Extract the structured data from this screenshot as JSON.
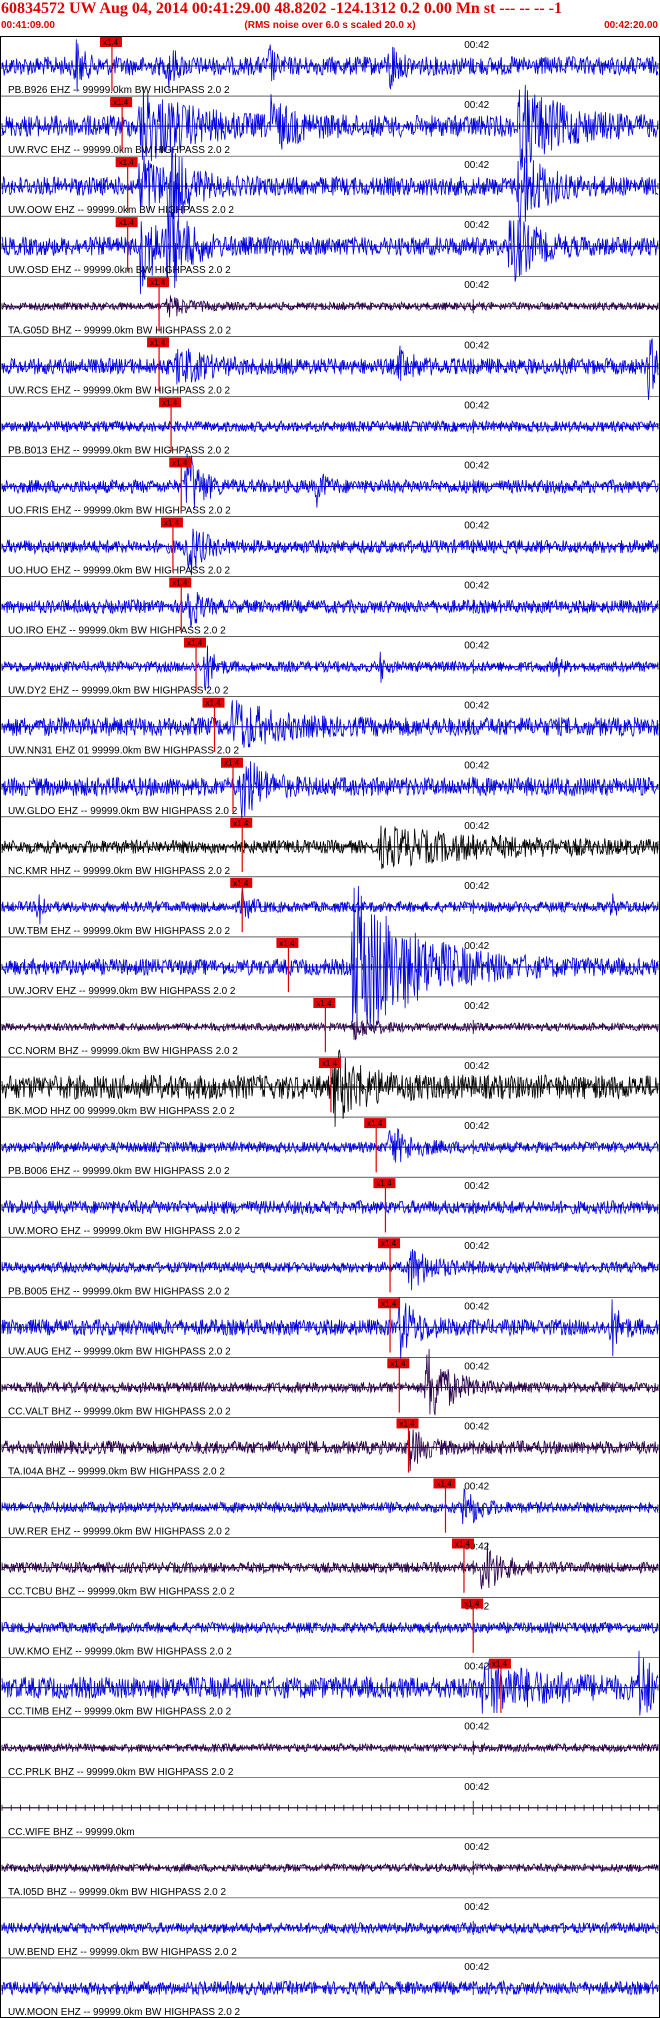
{
  "header": {
    "title": "60834572 UW Aug 04, 2014 00:41:29.00   48.8202 -124.1312  0.2 0.00 Mn st --- -- --  -1",
    "subtitle": "(RMS noise over 6.0 s scaled 20.0 x)",
    "start_time": "00:41:09.00",
    "end_time": "00:42:20.00"
  },
  "colors": {
    "header_text": "#e00000",
    "pick": "#e00000",
    "blue_trace": "#0000e0",
    "purple_trace": "#2a004a",
    "black_trace": "#000000",
    "grid": "#000000"
  },
  "chart_data": {
    "type": "seismogram",
    "x_start": "00:41:09.00",
    "x_end": "00:42:20.00",
    "minute_tick_label": "00:42",
    "pick_label": "x1.4",
    "filter": "HIGHPASS  2.0  2",
    "traces": [
      {
        "label": "PB.B926 EHZ -- 99999.0km BW  HIGHPASS  2.0  2",
        "color": "blue",
        "amplitude": 0.35,
        "pick": "00:41:20.9",
        "events": [
          [
            "00:41:17",
            0.9,
            1.5
          ],
          [
            "00:41:27",
            0.8,
            1.5
          ],
          [
            "00:41:38",
            0.7,
            1.0
          ],
          [
            "00:41:51",
            1.0,
            1.5
          ]
        ]
      },
      {
        "label": "UW.RVC EHZ -- 99999.0km BW  HIGHPASS  2.0  2",
        "color": "blue",
        "amplitude": 0.4,
        "pick": "00:41:22.0",
        "events": [
          [
            "00:41:24",
            1.3,
            10
          ],
          [
            "00:41:38",
            0.8,
            5
          ],
          [
            "00:42:05",
            1.4,
            9
          ]
        ]
      },
      {
        "label": "UW.OOW EHZ -- 99999.0km BW  HIGHPASS  2.0  2",
        "color": "blue",
        "amplitude": 0.35,
        "pick": "00:41:22.6",
        "events": [
          [
            "00:41:24",
            1.2,
            5
          ],
          [
            "00:41:27",
            1.4,
            4
          ],
          [
            "00:42:05",
            1.6,
            5
          ]
        ]
      },
      {
        "label": "UW.OSD EHZ -- 99999.0km BW  HIGHPASS  2.0  2",
        "color": "blue",
        "amplitude": 0.35,
        "pick": "00:41:22.6",
        "events": [
          [
            "00:41:24",
            1.5,
            4
          ],
          [
            "00:41:27",
            1.6,
            4
          ],
          [
            "00:42:04",
            1.3,
            5
          ]
        ]
      },
      {
        "label": "TA.G05D BHZ -- 99999.0km BW  HIGHPASS  2.0  2",
        "color": "purple",
        "amplitude": 0.15,
        "pick": "00:41:26.0",
        "events": [
          [
            "00:41:27",
            0.4,
            4
          ]
        ]
      },
      {
        "label": "UW.RCS EHZ -- 99999.0km BW  HIGHPASS  2.0  2",
        "color": "blue",
        "amplitude": 0.3,
        "pick": "00:41:26.0",
        "events": [
          [
            "00:41:28",
            0.6,
            6
          ],
          [
            "00:41:52",
            0.5,
            3
          ],
          [
            "00:42:19",
            1.1,
            2
          ]
        ]
      },
      {
        "label": "PB.B013 EHZ -- 99999.0km BW  HIGHPASS  2.0  2",
        "color": "blue",
        "amplitude": 0.2,
        "pick": "00:41:27.3",
        "events": []
      },
      {
        "label": "UO.FRIS EHZ -- 99999.0km BW  HIGHPASS  2.0  2",
        "color": "blue",
        "amplitude": 0.25,
        "pick": "00:41:28.4",
        "events": [
          [
            "00:41:29",
            1.4,
            3
          ],
          [
            "00:41:43",
            0.6,
            2
          ]
        ]
      },
      {
        "label": "UO.HUO EHZ -- 99999.0km BW  HIGHPASS  2.0  2",
        "color": "blue",
        "amplitude": 0.25,
        "pick": "00:41:27.5",
        "events": [
          [
            "00:41:29",
            1.2,
            3
          ]
        ]
      },
      {
        "label": "UO.IRO EHZ -- 99999.0km BW  HIGHPASS  2.0  2",
        "color": "blue",
        "amplitude": 0.25,
        "pick": "00:41:28.4",
        "events": [
          [
            "00:41:29",
            1.3,
            2
          ]
        ]
      },
      {
        "label": "UW.DY2 EHZ -- 99999.0km BW  HIGHPASS  2.0  2",
        "color": "blue",
        "amplitude": 0.2,
        "pick": "00:41:30.0",
        "events": [
          [
            "00:41:31",
            0.9,
            2
          ],
          [
            "00:41:50",
            0.5,
            1
          ],
          [
            "00:42:09",
            0.4,
            1
          ]
        ]
      },
      {
        "label": "UW.NN31 EHZ 01 99999.0km BW  HIGHPASS  2.0  2",
        "color": "blue",
        "amplitude": 0.35,
        "pick": "00:41:32.0",
        "events": [
          [
            "00:41:34",
            0.9,
            8
          ]
        ]
      },
      {
        "label": "UW.GLDO EHZ -- 99999.0km BW  HIGHPASS  2.0  2",
        "color": "blue",
        "amplitude": 0.35,
        "pick": "00:41:34.0",
        "events": [
          [
            "00:41:35",
            1.2,
            4
          ]
        ]
      },
      {
        "label": "NC.KMR HHZ -- 99999.0km BW  HIGHPASS  2.0  2",
        "color": "black",
        "amplitude": 0.25,
        "pick": "00:41:35.0",
        "events": [
          [
            "00:41:50",
            0.6,
            25
          ]
        ]
      },
      {
        "label": "UW.TBM EHZ -- 99999.0km BW  HIGHPASS  2.0  2",
        "color": "blue",
        "amplitude": 0.2,
        "pick": "00:41:35.0",
        "events": [
          [
            "00:41:13",
            0.9,
            1
          ],
          [
            "00:41:35",
            0.5,
            2
          ],
          [
            "00:42:15",
            0.4,
            1
          ]
        ]
      },
      {
        "label": "UW.JORV EHZ -- 99999.0km BW  HIGHPASS  2.0  2",
        "color": "blue",
        "amplitude": 0.3,
        "pick": "00:41:40.0",
        "events": [
          [
            "00:41:47",
            3.0,
            14
          ]
        ]
      },
      {
        "label": "CC.NORM BHZ -- 99999.0km BW  HIGHPASS  2.0  2",
        "color": "purple",
        "amplitude": 0.15,
        "pick": "00:41:44.0",
        "events": [
          [
            "00:41:47",
            0.4,
            5
          ]
        ]
      },
      {
        "label": "BK.MOD HHZ 00 99999.0km BW  HIGHPASS  2.0  2",
        "color": "black",
        "amplitude": 0.45,
        "pick": "00:41:44.6",
        "events": [
          [
            "00:41:45",
            1.2,
            6
          ]
        ]
      },
      {
        "label": "PB.B006 EHZ -- 99999.0km BW  HIGHPASS  2.0  2",
        "color": "blue",
        "amplitude": 0.2,
        "pick": "00:41:49.5",
        "events": [
          [
            "00:41:51",
            0.7,
            5
          ]
        ]
      },
      {
        "label": "UW.MORO EHZ -- 99999.0km BW  HIGHPASS  2.0  2",
        "color": "blue",
        "amplitude": 0.25,
        "pick": "00:41:50.5",
        "events": []
      },
      {
        "label": "PB.B005 EHZ -- 99999.0km BW  HIGHPASS  2.0  2",
        "color": "blue",
        "amplitude": 0.2,
        "pick": "00:41:51.0",
        "events": [
          [
            "00:41:53",
            0.8,
            5
          ]
        ]
      },
      {
        "label": "UW.AUG EHZ -- 99999.0km BW  HIGHPASS  2.0  2",
        "color": "blue",
        "amplitude": 0.3,
        "pick": "00:41:51.0",
        "events": [
          [
            "00:41:52",
            1.0,
            4
          ],
          [
            "00:42:15",
            0.9,
            2
          ]
        ]
      },
      {
        "label": "CC.VALT BHZ -- 99999.0km BW  HIGHPASS  2.0  2",
        "color": "purple",
        "amplitude": 0.2,
        "pick": "00:41:52.0",
        "events": [
          [
            "00:41:55",
            1.5,
            5
          ]
        ]
      },
      {
        "label": "TA.I04A BHZ -- 99999.0km BW  HIGHPASS  2.0  2",
        "color": "purple",
        "amplitude": 0.25,
        "pick": "00:41:53.0",
        "events": [
          [
            "00:41:53",
            0.8,
            3
          ]
        ]
      },
      {
        "label": "UW.RER EHZ -- 99999.0km BW  HIGHPASS  2.0  2",
        "color": "blue",
        "amplitude": 0.2,
        "pick": "00:41:57.0",
        "events": [
          [
            "00:41:59",
            0.9,
            3
          ]
        ]
      },
      {
        "label": "CC.TCBU BHZ -- 99999.0km BW  HIGHPASS  2.0  2",
        "color": "purple",
        "amplitude": 0.2,
        "pick": "00:41:59.0",
        "events": [
          [
            "00:42:01",
            1.1,
            4
          ]
        ]
      },
      {
        "label": "UW.KMO EHZ -- 99999.0km BW  HIGHPASS  2.0  2",
        "color": "blue",
        "amplitude": 0.2,
        "pick": "00:42:00.0",
        "events": []
      },
      {
        "label": "CC.TIMB EHZ -- 99999.0km BW  HIGHPASS  2.0  2",
        "color": "blue",
        "amplitude": 0.4,
        "pick": "00:42:03.0",
        "events": [
          [
            "00:42:01",
            0.8,
            14
          ],
          [
            "00:42:18",
            1.2,
            3
          ]
        ]
      },
      {
        "label": "CC.PRLK BHZ -- 99999.0km BW  HIGHPASS  2.0  2",
        "color": "purple",
        "amplitude": 0.15,
        "pick": null,
        "events": []
      },
      {
        "label": "CC.WIFE BHZ -- 99999.0km",
        "color": "purple",
        "amplitude": 0.0,
        "pick": null,
        "events": []
      },
      {
        "label": "TA.I05D BHZ -- 99999.0km BW  HIGHPASS  2.0  2",
        "color": "purple",
        "amplitude": 0.15,
        "pick": null,
        "events": []
      },
      {
        "label": "UW.BEND EHZ -- 99999.0km BW  HIGHPASS  2.0  2",
        "color": "blue",
        "amplitude": 0.2,
        "pick": null,
        "events": []
      },
      {
        "label": "UW.MOON EHZ -- 99999.0km BW  HIGHPASS  2.0  2",
        "color": "blue",
        "amplitude": 0.25,
        "pick": null,
        "events": []
      }
    ]
  }
}
